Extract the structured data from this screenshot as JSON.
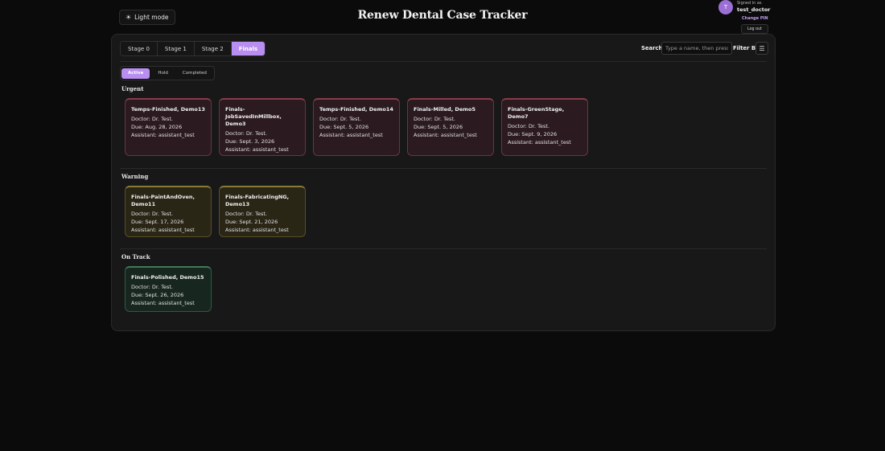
{
  "header": {
    "light_mode_icon": "sun-icon",
    "light_mode_label": "Light mode",
    "title": "Renew Dental Case Tracker",
    "avatar_initial": "T",
    "signed_in_label": "Signed in as",
    "username": "test_doctor",
    "change_pin_label": "Change PIN",
    "logout_label": "Log out"
  },
  "toolbar": {
    "stage_tabs": [
      "Stage 0",
      "Stage 1",
      "Stage 2",
      "Finals"
    ],
    "active_stage": "Finals",
    "search_label": "Search",
    "search_placeholder": "Type a name, then press",
    "search_value": "",
    "filter_label": "Filter By:",
    "filter_icon": "hamburger-menu-icon"
  },
  "status_tabs": [
    "Active",
    "Hold",
    "Completed"
  ],
  "active_status": "Active",
  "groups": {
    "urgent": {
      "label": "Urgent",
      "cards": [
        {
          "name": "Temps-Finished, Demo13",
          "doctor": "Doctor: Dr. Test.",
          "due": "Due: Aug. 28, 2026",
          "assistant": "Assistant: assistant_test"
        },
        {
          "name": "Finals-JobSavedInMillbox, Demo3",
          "doctor": "Doctor: Dr. Test.",
          "due": "Due: Sept. 3, 2026",
          "assistant": "Assistant: assistant_test"
        },
        {
          "name": "Temps-Finished, Demo14",
          "doctor": "Doctor: Dr. Test.",
          "due": "Due: Sept. 5, 2026",
          "assistant": "Assistant: assistant_test"
        },
        {
          "name": "Finals-Milled, Demo5",
          "doctor": "Doctor: Dr. Test.",
          "due": "Due: Sept. 5, 2026",
          "assistant": "Assistant: assistant_test"
        },
        {
          "name": "Finals-GreenStage, Demo7",
          "doctor": "Doctor: Dr. Test.",
          "due": "Due: Sept. 9, 2026",
          "assistant": "Assistant: assistant_test"
        }
      ]
    },
    "warning": {
      "label": "Warning",
      "cards": [
        {
          "name": "Finals-PaintAndOven, Demo11",
          "doctor": "Doctor: Dr. Test.",
          "due": "Due: Sept. 17, 2026",
          "assistant": "Assistant: assistant_test"
        },
        {
          "name": "Finals-FabricatingNG, Demo13",
          "doctor": "Doctor: Dr. Test.",
          "due": "Due: Sept. 21, 2026",
          "assistant": "Assistant: assistant_test"
        }
      ]
    },
    "ontrack": {
      "label": "On Track",
      "cards": [
        {
          "name": "Finals-Polished, Demo15",
          "doctor": "Doctor: Dr. Test.",
          "due": "Due: Sept. 26, 2026",
          "assistant": "Assistant: assistant_test"
        }
      ]
    }
  },
  "colors": {
    "accent": "#b88ef0",
    "urgent": "#8a3d4a",
    "warning": "#8a7a3a",
    "ontrack": "#3e7a5a"
  }
}
